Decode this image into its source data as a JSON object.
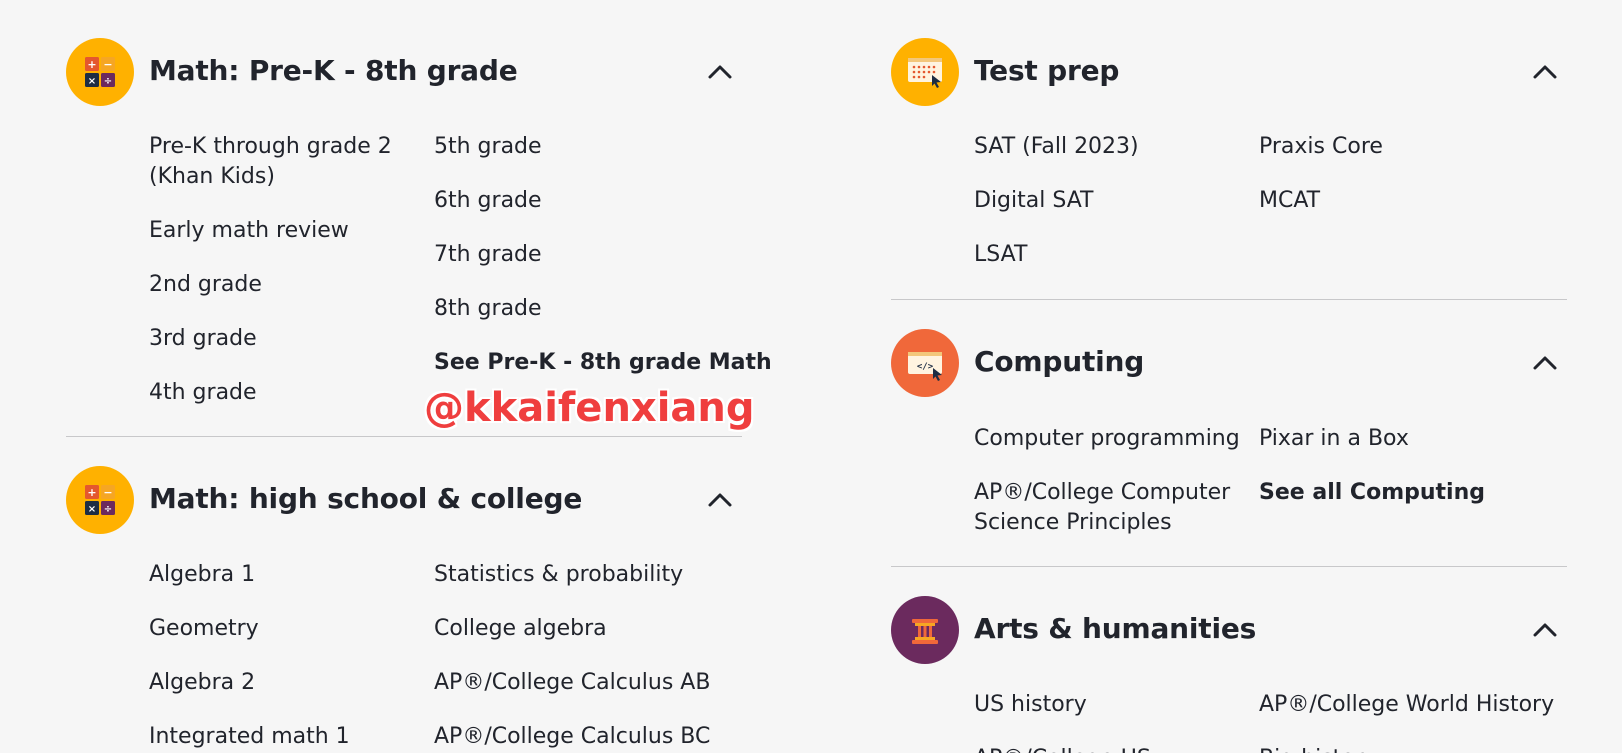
{
  "math_prek": {
    "title": "Math: Pre-K - 8th grade",
    "icon": "math-operations-icon",
    "icon_color": "#ffb100",
    "col1": [
      "Pre-K through grade 2",
      "(Khan Kids)",
      "Early math review",
      "2nd grade",
      "3rd grade",
      "4th grade"
    ],
    "col2": [
      "5th grade",
      "6th grade",
      "7th grade",
      "8th grade"
    ],
    "see_all": "See Pre-K - 8th grade Math"
  },
  "math_hs": {
    "title": "Math: high school & college",
    "icon": "math-operations-icon",
    "icon_color": "#ffb100",
    "col1": [
      "Algebra 1",
      "Geometry",
      "Algebra 2",
      "Integrated math 1"
    ],
    "col2": [
      "Statistics & probability",
      "College algebra",
      "AP®/College Calculus AB",
      "AP®/College Calculus BC"
    ]
  },
  "test_prep": {
    "title": "Test prep",
    "icon": "test-grid-cursor-icon",
    "icon_color": "#ffb100",
    "col1": [
      "SAT (Fall 2023)",
      "Digital SAT",
      "LSAT"
    ],
    "col2": [
      "Praxis Core",
      "MCAT"
    ]
  },
  "computing": {
    "title": "Computing",
    "icon": "code-window-icon",
    "icon_color": "#f0683a",
    "col1": [
      "Computer programming",
      "AP®/College Computer",
      "Science Principles"
    ],
    "col2": [
      "Pixar in a Box"
    ],
    "see_all": "See all Computing"
  },
  "arts": {
    "title": "Arts & humanities",
    "icon": "column-pillar-icon",
    "icon_color": "#6b2a5e",
    "col1": [
      "US history",
      "AP®/College US"
    ],
    "col2": [
      "AP®/College World History",
      "Big history"
    ]
  },
  "watermark": "@kkaifenxiang"
}
